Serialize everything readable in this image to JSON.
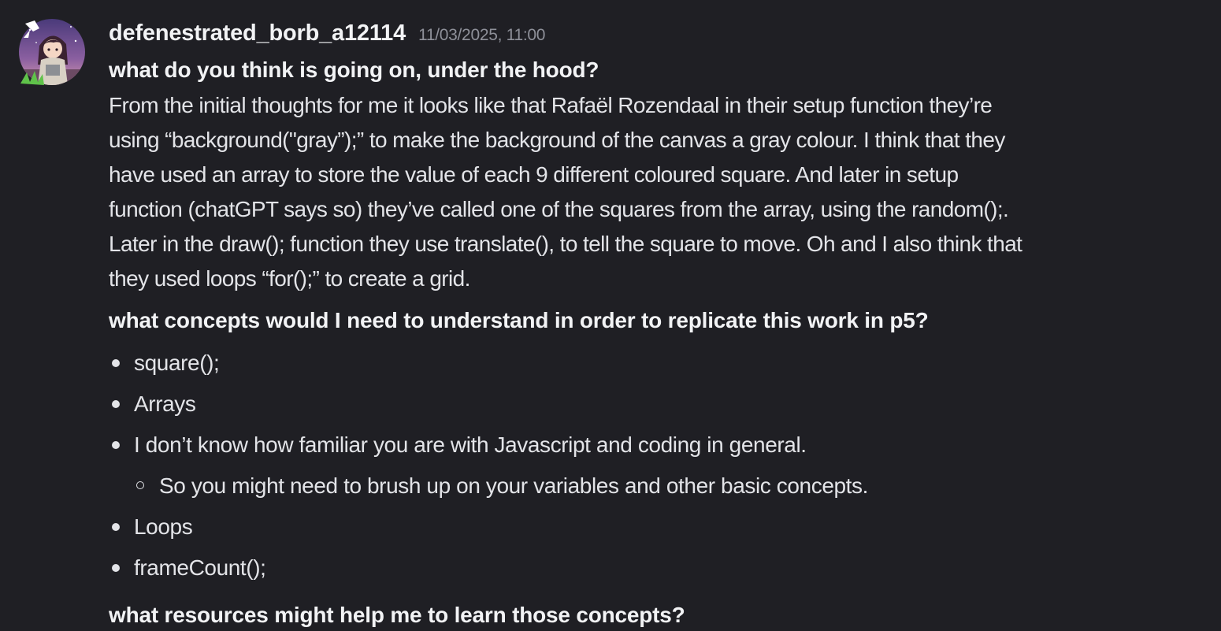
{
  "message": {
    "username": "defenestrated_borb_a12114",
    "timestamp": "11/03/2025, 11:00",
    "heading1": "what do you think is going on, under the hood?",
    "paragraph_lines": [
      "From the initial thoughts for me it looks like that Rafaël Rozendaal in their setup function they’re",
      "using “background(\"gray”);” to make the background of the canvas a gray colour. I think that they",
      "have used an array to store the value of each 9 different coloured square. And later in setup",
      "function (chatGPT says so) they’ve called one of the squares from the array, using the random();.",
      "Later in the draw(); function they use translate(), to tell the square to move. Oh and I also think that",
      "they used loops “for();” to create a grid."
    ],
    "heading2": "what concepts would I need to understand in order to replicate this work in p5?",
    "bullets": [
      "square();",
      "Arrays",
      "I don’t know how familiar you are with Javascript and coding in general.",
      "So you might need to brush up on your variables and other basic concepts.",
      "Loops",
      "frameCount();"
    ],
    "heading3": "what resources might help me to learn those concepts?"
  },
  "colors": {
    "background": "#1f1f24",
    "text": "#e3e4e8",
    "username": "#f2f3f5",
    "timestamp": "#8e9099"
  }
}
